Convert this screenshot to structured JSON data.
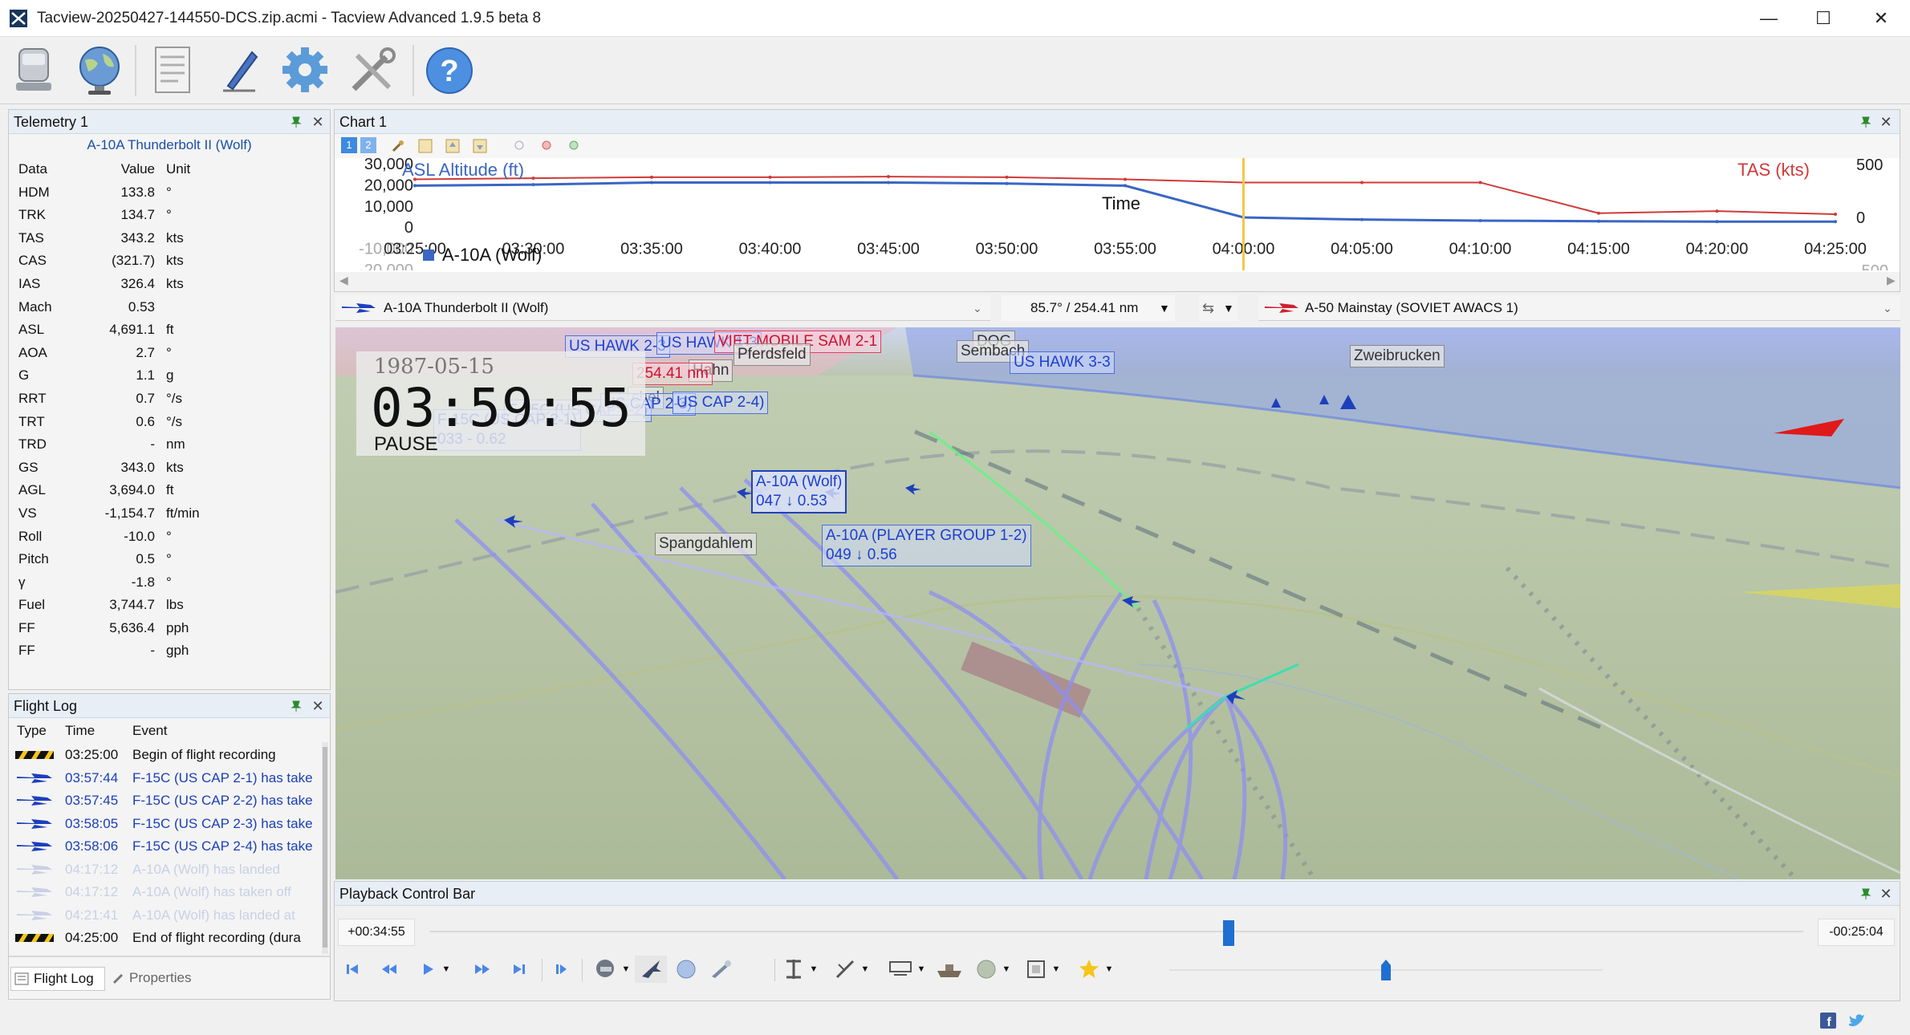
{
  "window": {
    "title": "Tacview-20250427-144550-DCS.zip.acmi - Tacview Advanced 1.9.5 beta 8",
    "controls": [
      "—",
      "☐",
      "✕"
    ]
  },
  "telemetry": {
    "panel_title": "Telemetry 1",
    "object_name": "A-10A Thunderbolt II (Wolf)",
    "headers": {
      "data": "Data",
      "value": "Value",
      "unit": "Unit"
    },
    "rows": [
      {
        "data": "HDM",
        "value": "133.8",
        "unit": "°"
      },
      {
        "data": "TRK",
        "value": "134.7",
        "unit": "°"
      },
      {
        "data": "TAS",
        "value": "343.2",
        "unit": "kts"
      },
      {
        "data": "CAS",
        "value": "(321.7)",
        "unit": "kts"
      },
      {
        "data": "IAS",
        "value": "326.4",
        "unit": "kts"
      },
      {
        "data": "Mach",
        "value": "0.53",
        "unit": ""
      },
      {
        "data": "ASL",
        "value": "4,691.1",
        "unit": "ft"
      },
      {
        "data": "AOA",
        "value": "2.7",
        "unit": "°"
      },
      {
        "data": "G",
        "value": "1.1",
        "unit": "g"
      },
      {
        "data": "RRT",
        "value": "0.7",
        "unit": "°/s"
      },
      {
        "data": "TRT",
        "value": "0.6",
        "unit": "°/s"
      },
      {
        "data": "TRD",
        "value": "-",
        "unit": "nm"
      },
      {
        "data": "GS",
        "value": "343.0",
        "unit": "kts"
      },
      {
        "data": "AGL",
        "value": "3,694.0",
        "unit": "ft"
      },
      {
        "data": "VS",
        "value": "-1,154.7",
        "unit": "ft/min"
      },
      {
        "data": "Roll",
        "value": "-10.0",
        "unit": "°"
      },
      {
        "data": "Pitch",
        "value": "0.5",
        "unit": "°"
      },
      {
        "data": "γ",
        "value": "-1.8",
        "unit": "°"
      },
      {
        "data": "Fuel",
        "value": "3,744.7",
        "unit": "lbs"
      },
      {
        "data": "FF",
        "value": "5,636.4",
        "unit": "pph"
      },
      {
        "data": "FF",
        "value": "-",
        "unit": "gph"
      }
    ]
  },
  "flight_log": {
    "panel_title": "Flight Log",
    "headers": {
      "type": "Type",
      "time": "Time",
      "event": "Event"
    },
    "rows": [
      {
        "type": "recording",
        "time": "03:25:00",
        "event": "Begin of flight recording",
        "style": "normal"
      },
      {
        "type": "aircraft",
        "time": "03:57:44",
        "event": "F-15C (US CAP 2-1) has take",
        "style": "blue"
      },
      {
        "type": "aircraft",
        "time": "03:57:45",
        "event": "F-15C (US CAP 2-2) has take",
        "style": "blue"
      },
      {
        "type": "aircraft",
        "time": "03:58:05",
        "event": "F-15C (US CAP 2-3) has take",
        "style": "blue"
      },
      {
        "type": "aircraft",
        "time": "03:58:06",
        "event": "F-15C (US CAP 2-4) has take",
        "style": "blue"
      },
      {
        "type": "aircraft",
        "time": "04:17:12",
        "event": "A-10A (Wolf) has landed",
        "style": "faded"
      },
      {
        "type": "aircraft",
        "time": "04:17:12",
        "event": "A-10A (Wolf) has taken off",
        "style": "faded"
      },
      {
        "type": "aircraft",
        "time": "04:21:41",
        "event": "A-10A (Wolf) has landed at",
        "style": "faded"
      },
      {
        "type": "recording",
        "time": "04:25:00",
        "event": "End of flight recording (dura",
        "style": "normal"
      }
    ],
    "tabs": [
      "Flight Log",
      "Properties"
    ]
  },
  "chart": {
    "panel_title": "Chart 1",
    "toolbar_buttons": [
      "1",
      "2"
    ],
    "left_axis_ticks": [
      "30,000",
      "20,000",
      "10,000",
      "0",
      "-10,000",
      "-20,000"
    ],
    "right_axis_ticks": [
      "500",
      "0",
      "-500"
    ],
    "left_series_label": "ASL Altitude (ft)",
    "right_series_label": "TAS (kts)",
    "x_title": "Time",
    "x_ticks": [
      "03:25:00",
      "03:30:00",
      "03:35:00",
      "03:40:00",
      "03:45:00",
      "03:50:00",
      "03:55:00",
      "04:00:00",
      "04:05:00",
      "04:10:00",
      "04:15:00",
      "04:20:00",
      "04:25:00"
    ],
    "legend": "A-10A (Wolf)",
    "colors": {
      "altitude": "#3a66c4",
      "tas": "#d03a3a",
      "cursor": "#f2c84b"
    }
  },
  "chart_data": {
    "type": "line",
    "x": [
      "03:25:00",
      "03:30:00",
      "03:35:00",
      "03:40:00",
      "03:45:00",
      "03:50:00",
      "03:55:00",
      "04:00:00",
      "04:05:00",
      "04:10:00",
      "04:15:00",
      "04:20:00",
      "04:25:00"
    ],
    "series": [
      {
        "name": "ASL Altitude (ft)",
        "axis": "left",
        "values": [
          20000,
          20500,
          21500,
          21500,
          21500,
          21000,
          20000,
          5000,
          4000,
          3500,
          3200,
          3000,
          3000
        ]
      },
      {
        "name": "TAS (kts)",
        "axis": "right",
        "values": [
          360,
          370,
          380,
          380,
          385,
          380,
          360,
          330,
          330,
          330,
          40,
          60,
          30
        ]
      }
    ],
    "ylim_left": [
      -20000,
      30000
    ],
    "ylim_right": [
      -500,
      500
    ],
    "xlabel": "Time",
    "legend_position": "bottom-left"
  },
  "object_bar": {
    "primary": "A-10A Thunderbolt II (Wolf)",
    "bearing_range": "85.7° / 254.41 nm",
    "secondary": "A-50 Mainstay (SOVIET AWACS 1)"
  },
  "scene": {
    "date": "1987-05-15",
    "time": "03:59:55",
    "state": "PAUSE",
    "labels": [
      {
        "text": "US HAWK 2-3",
        "style": "blue"
      },
      {
        "text": "US HAWK 1-3",
        "style": "blue"
      },
      {
        "text": "VIET MOBILE SAM 2-1",
        "style": "red"
      },
      {
        "text": "DQG",
        "style": "gray"
      },
      {
        "text": "Pferdsfeld",
        "style": "gray"
      },
      {
        "text": "Hahn",
        "style": "gray"
      },
      {
        "text": "Sembach",
        "style": "gray"
      },
      {
        "text": "US HAWK 3-3",
        "style": "blue"
      },
      {
        "text": "Zweibrucken",
        "style": "gray"
      },
      {
        "text": "254.41 nm",
        "style": "red"
      },
      {
        "text": "chel",
        "style": "gray"
      },
      {
        "text": "F-15C (US CAP 2-2)",
        "style": "blue"
      },
      {
        "text": "US CAP 2-3)",
        "style": "blue"
      },
      {
        "text": "US CAP 2-4)",
        "style": "blue"
      },
      {
        "text": "F-15C (US CAP 2-1)",
        "style": "blue",
        "sub": "033 - 0.62"
      },
      {
        "text": "A-10A (Wolf)",
        "style": "sel",
        "sub": "047 ↓ 0.53"
      },
      {
        "text": "Spangdahlem",
        "style": "gray"
      },
      {
        "text": "A-10A (PLAYER GROUP 1-2)",
        "style": "blue",
        "sub": "049 ↓ 0.56"
      }
    ]
  },
  "playback": {
    "panel_title": "Playback Control Bar",
    "elapsed": "+00:34:55",
    "remaining": "-00:25:04",
    "progress_fraction": 0.5815
  }
}
